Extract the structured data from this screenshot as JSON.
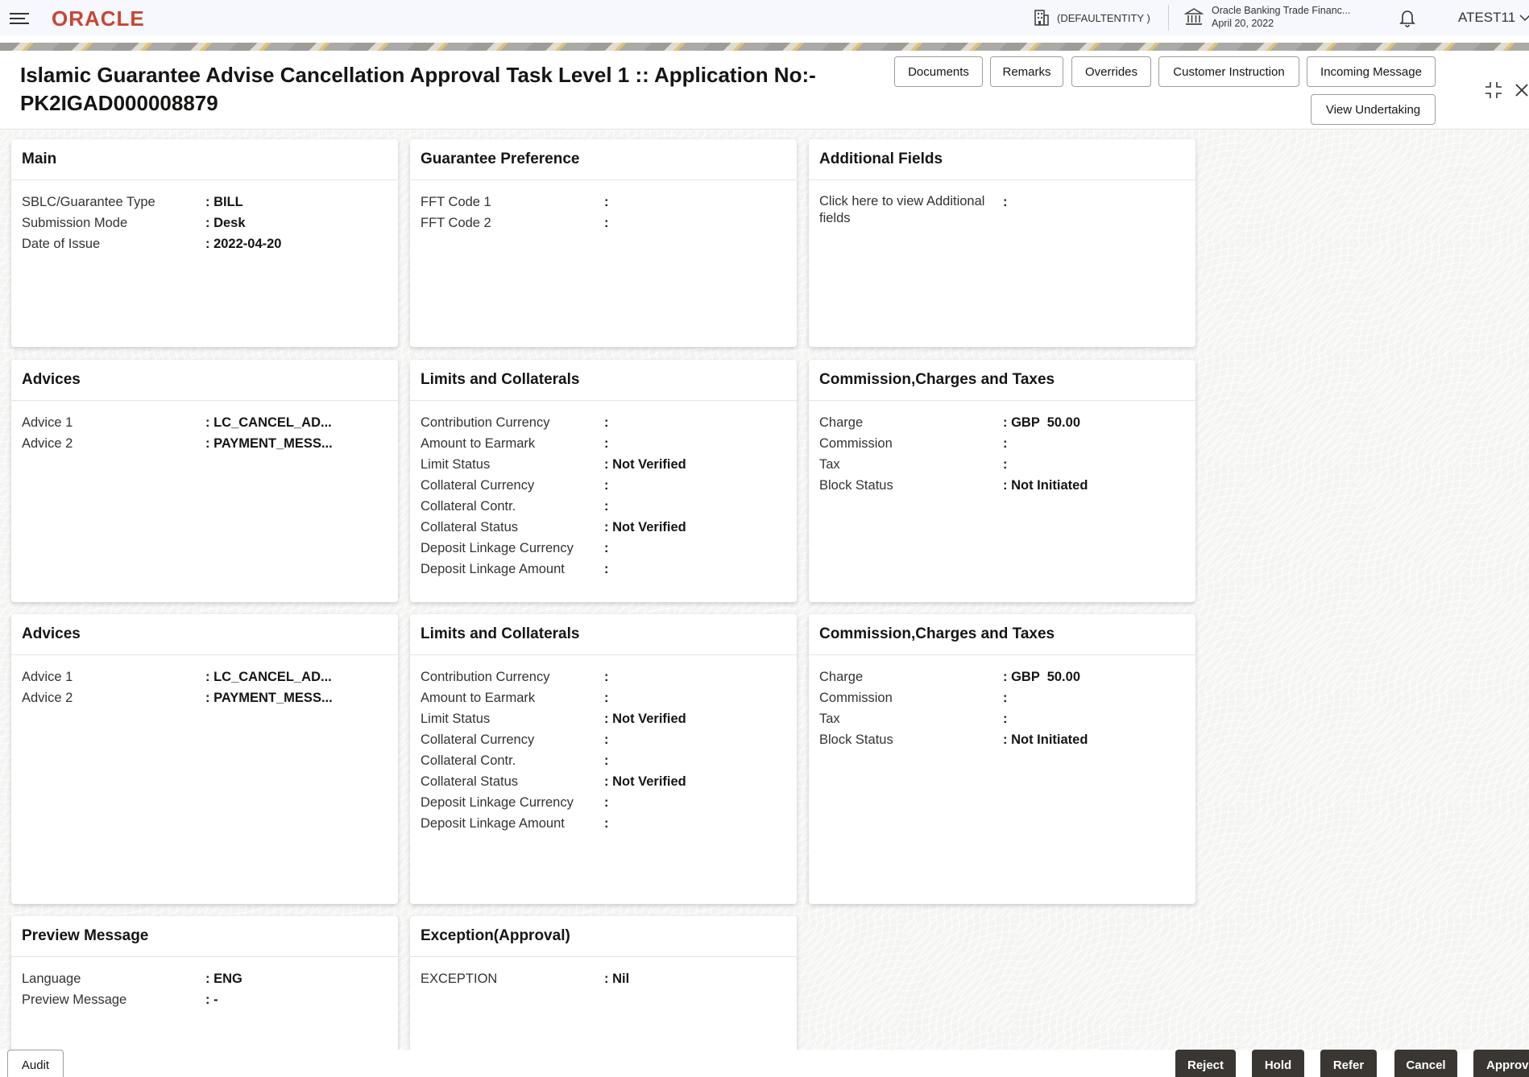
{
  "topbar": {
    "brand": "ORACLE",
    "entity": "(DEFAULTENTITY )",
    "app_name": "Oracle Banking Trade Financ...",
    "app_date": "April 20, 2022",
    "user": "ATEST11"
  },
  "header": {
    "title_line1": "Islamic Guarantee Advise Cancellation Approval Task Level 1 :: Application No:-",
    "title_line2": "PK2IGAD000008879",
    "buttons": {
      "documents": "Documents",
      "remarks": "Remarks",
      "overrides": "Overrides",
      "customer_instruction": "Customer Instruction",
      "incoming_message": "Incoming Message",
      "view_undertaking": "View Undertaking"
    }
  },
  "cards": {
    "main": {
      "title": "Main",
      "rows": [
        {
          "label": "SBLC/Guarantee Type",
          "value": ": BILL"
        },
        {
          "label": "Submission Mode",
          "value": ": Desk"
        },
        {
          "label": "Date of Issue",
          "value": ": 2022-04-20"
        }
      ]
    },
    "guarantee_preference": {
      "title": "Guarantee Preference",
      "rows": [
        {
          "label": "FFT Code 1",
          "value": ":"
        },
        {
          "label": "FFT Code 2",
          "value": ":"
        }
      ]
    },
    "additional_fields": {
      "title": "Additional Fields",
      "rows": [
        {
          "label": "Click here to view Additional fields",
          "value": ":"
        }
      ]
    },
    "advices_1": {
      "title": "Advices",
      "rows": [
        {
          "label": "Advice 1",
          "value": ": LC_CANCEL_AD..."
        },
        {
          "label": "Advice 2",
          "value": ": PAYMENT_MESS..."
        }
      ]
    },
    "limits_1": {
      "title": "Limits and Collaterals",
      "rows": [
        {
          "label": "Contribution Currency",
          "value": ":"
        },
        {
          "label": "Amount to Earmark",
          "value": ":"
        },
        {
          "label": "Limit Status",
          "value": ": Not Verified"
        },
        {
          "label": "Collateral Currency",
          "value": ":"
        },
        {
          "label": "Collateral Contr.",
          "value": ":"
        },
        {
          "label": "Collateral Status",
          "value": ": Not Verified"
        },
        {
          "label": "Deposit Linkage Currency",
          "value": ":"
        },
        {
          "label": "Deposit Linkage Amount",
          "value": ":"
        }
      ]
    },
    "charges_1": {
      "title": "Commission,Charges and Taxes",
      "rows": [
        {
          "label": "Charge",
          "value": ": GBP  50.00"
        },
        {
          "label": "Commission",
          "value": ":"
        },
        {
          "label": "Tax",
          "value": ":"
        },
        {
          "label": "Block Status",
          "value": ": Not Initiated"
        }
      ]
    },
    "advices_2": {
      "title": "Advices",
      "rows": [
        {
          "label": "Advice 1",
          "value": ": LC_CANCEL_AD..."
        },
        {
          "label": "Advice 2",
          "value": ": PAYMENT_MESS..."
        }
      ]
    },
    "limits_2": {
      "title": "Limits and Collaterals",
      "rows": [
        {
          "label": "Contribution Currency",
          "value": ":"
        },
        {
          "label": "Amount to Earmark",
          "value": ":"
        },
        {
          "label": "Limit Status",
          "value": ": Not Verified"
        },
        {
          "label": "Collateral Currency",
          "value": ":"
        },
        {
          "label": "Collateral Contr.",
          "value": ":"
        },
        {
          "label": "Collateral Status",
          "value": ": Not Verified"
        },
        {
          "label": "Deposit Linkage Currency",
          "value": ":"
        },
        {
          "label": "Deposit Linkage Amount",
          "value": ":"
        }
      ]
    },
    "charges_2": {
      "title": "Commission,Charges and Taxes",
      "rows": [
        {
          "label": "Charge",
          "value": ": GBP  50.00"
        },
        {
          "label": "Commission",
          "value": ":"
        },
        {
          "label": "Tax",
          "value": ":"
        },
        {
          "label": "Block Status",
          "value": ": Not Initiated"
        }
      ]
    },
    "preview_message": {
      "title": "Preview Message",
      "rows": [
        {
          "label": "Language",
          "value": ": ENG"
        },
        {
          "label": "Preview Message",
          "value": ": -"
        }
      ]
    },
    "exception": {
      "title": "Exception(Approval)",
      "rows": [
        {
          "label": "EXCEPTION",
          "value": ": Nil"
        }
      ]
    }
  },
  "footer": {
    "audit": "Audit",
    "reject": "Reject",
    "hold": "Hold",
    "refer": "Refer",
    "cancel": "Cancel",
    "approve": "Approve"
  },
  "icons": [
    "menu-icon",
    "building-icon",
    "bank-icon",
    "bell-icon",
    "chevron-down-icon",
    "collapse-icon",
    "close-icon"
  ]
}
